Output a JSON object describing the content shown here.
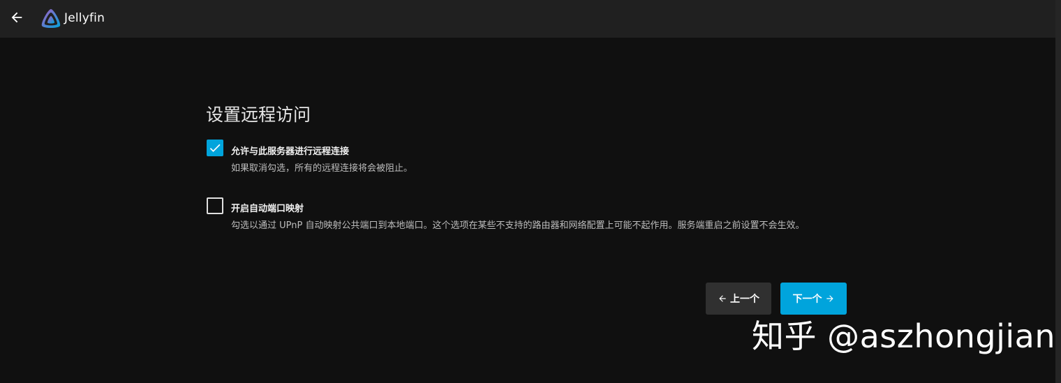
{
  "header": {
    "app_title": "Jellyfin",
    "back_icon": "arrow-left-icon",
    "logo_icon": "jellyfin-logo-icon"
  },
  "page": {
    "title": "设置远程访问"
  },
  "options": [
    {
      "label": "允许与此服务器进行远程连接",
      "description": "如果取消勾选，所有的远程连接将会被阻止。",
      "checked": true
    },
    {
      "label": "开启自动端口映射",
      "description": "勾选以通过 UPnP 自动映射公共端口到本地端口。这个选项在某些不支持的路由器和网络配置上可能不起作用。服务端重启之前设置不会生效。",
      "checked": false
    }
  ],
  "buttons": {
    "prev_label": "上一个",
    "next_label": "下一个"
  },
  "watermark": "知乎 @aszhongjian",
  "colors": {
    "accent": "#00a4dc",
    "background": "#101010",
    "header": "#202020"
  }
}
